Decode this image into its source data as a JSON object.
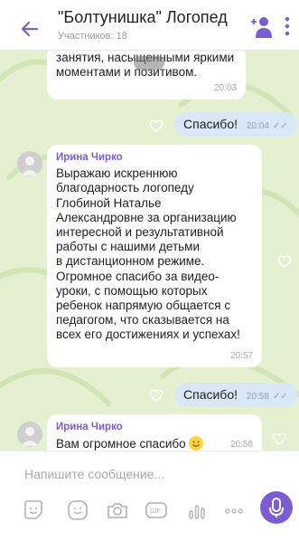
{
  "header": {
    "title": "\"Болтунишка\" Логопед",
    "subtitle": "Участников: 18"
  },
  "messages": {
    "m1": {
      "text_line1": "занятия, насыщенными яркими",
      "text_line2": "моментами и позитивом.",
      "time": "20:03"
    },
    "m2": {
      "text": "Спасибо!",
      "time": "20:04"
    },
    "m3": {
      "sender": "Ирина Чирко",
      "lines": [
        "Выражаю искреннюю",
        "благодарность логопеду",
        "Глобиной Наталье",
        "Александровне за организацию",
        "интересной и результативной",
        "работы с нашими детьми",
        "в дистанционном режиме.",
        "Огромное спасибо за видео-",
        "уроки, с помощью которых",
        "ребенок  напрямую общается с",
        "педагогом, что  сказывается на",
        "всех его достижениях и успехах!"
      ],
      "time": "20:57"
    },
    "m4": {
      "text": "Спасибо!",
      "time": "20:58"
    },
    "m5": {
      "sender": "Ирина Чирко",
      "text": "Вам огромное спасибо",
      "time": "20:58"
    }
  },
  "composer": {
    "placeholder": "Напишите сообщение..."
  },
  "colors": {
    "accent": "#7b5cd3",
    "chat_bg": "#e4f0d0",
    "outgoing": "#d9e7f6"
  }
}
